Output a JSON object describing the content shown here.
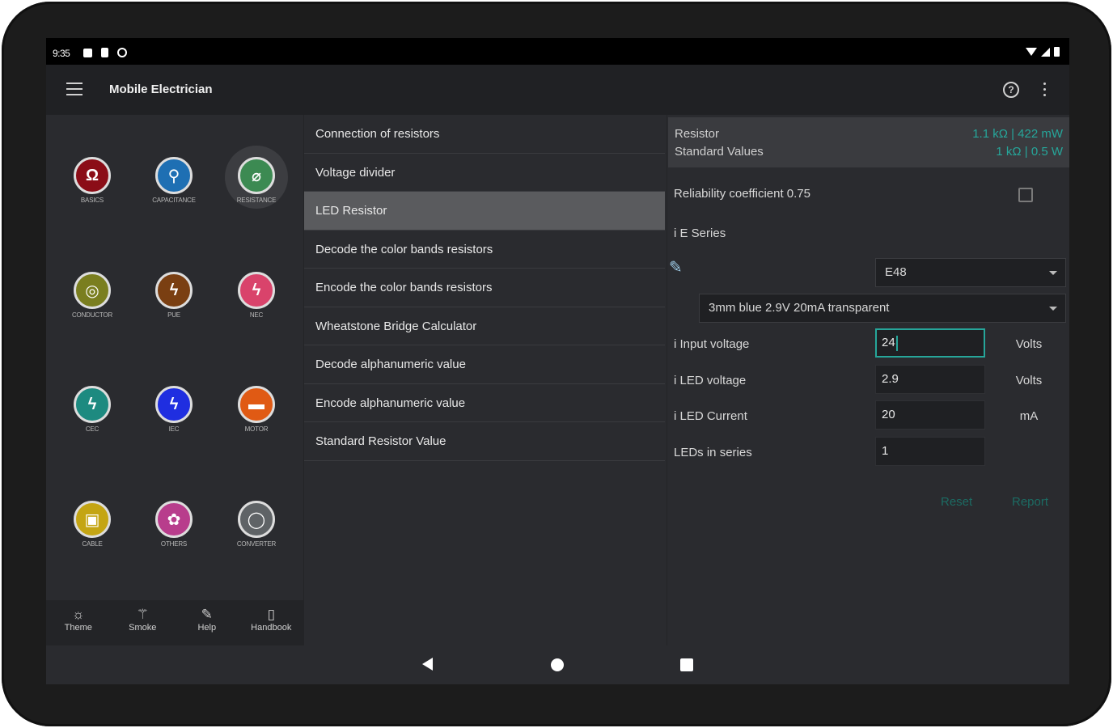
{
  "status": {
    "time": "9:35"
  },
  "appbar": {
    "title": "Mobile Electrician",
    "help_glyph": "?"
  },
  "categories": [
    {
      "label": "BASICS",
      "icon": "ohm-icon",
      "glyph": "Ω",
      "color": "#8b0d17"
    },
    {
      "label": "CAPACITANCE",
      "icon": "capacitor-icon",
      "glyph": "⚲",
      "color": "#1e6fb3"
    },
    {
      "label": "RESISTANCE",
      "icon": "resistor-icon",
      "glyph": "⌀",
      "color": "#3c8a52"
    },
    {
      "label": "CONDUCTOR",
      "icon": "conductor-icon",
      "glyph": "◎",
      "color": "#7a7e1f"
    },
    {
      "label": "PUE",
      "icon": "bolt-icon",
      "glyph": "ϟ",
      "color": "#7a3f12"
    },
    {
      "label": "NEC",
      "icon": "bolt-icon",
      "glyph": "ϟ",
      "color": "#d9436b"
    },
    {
      "label": "CEC",
      "icon": "bolt-icon",
      "glyph": "ϟ",
      "color": "#1d8a80"
    },
    {
      "label": "IEC",
      "icon": "bolt-icon",
      "glyph": "ϟ",
      "color": "#1f2ee0"
    },
    {
      "label": "MOTOR",
      "icon": "motor-icon",
      "glyph": "▬",
      "color": "#e05a14"
    },
    {
      "label": "CABLE",
      "icon": "cable-icon",
      "glyph": "▣",
      "color": "#c4a514"
    },
    {
      "label": "OTHERS",
      "icon": "gear-icon",
      "glyph": "✿",
      "color": "#b83d8c"
    },
    {
      "label": "CONVERTER",
      "icon": "converter-icon",
      "glyph": "◯",
      "color": "#5f6366"
    }
  ],
  "bottom_tabs": [
    {
      "label": "Theme",
      "icon": "theme-icon",
      "glyph": "☼"
    },
    {
      "label": "Smoke",
      "icon": "smoke-icon",
      "glyph": "⚚"
    },
    {
      "label": "Help",
      "icon": "help-icon",
      "glyph": "✎"
    },
    {
      "label": "Handbook",
      "icon": "handbook-icon",
      "glyph": "▯"
    }
  ],
  "menu": [
    "Connection of resistors",
    "Voltage divider",
    "LED Resistor",
    "Decode the color bands resistors",
    "Encode the color bands resistors",
    "Wheatstone Bridge Calculator",
    "Decode alphanumeric value",
    "Encode alphanumeric value",
    "Standard Resistor Value"
  ],
  "result": {
    "label1": "Resistor",
    "label2": "Standard Values",
    "value1": "1.1 kΩ | 422 mW",
    "value2": "1 kΩ | 0.5 W"
  },
  "form": {
    "reliability_label": "Reliability coefficient 0.75",
    "eseries_label": "i E Series",
    "eseries_value": "E48",
    "led_type_value": "3mm blue 2.9V 20mA transparent",
    "input_voltage_label": "i Input voltage",
    "input_voltage_value": "24",
    "input_voltage_unit": "Volts",
    "led_voltage_label": "i LED voltage",
    "led_voltage_value": "2.9",
    "led_voltage_unit": "Volts",
    "led_current_label": "i LED Current",
    "led_current_value": "20",
    "led_current_unit": "mA",
    "leds_series_label": "LEDs in series",
    "leds_series_value": "1",
    "reset_label": "Reset",
    "report_label": "Report"
  }
}
